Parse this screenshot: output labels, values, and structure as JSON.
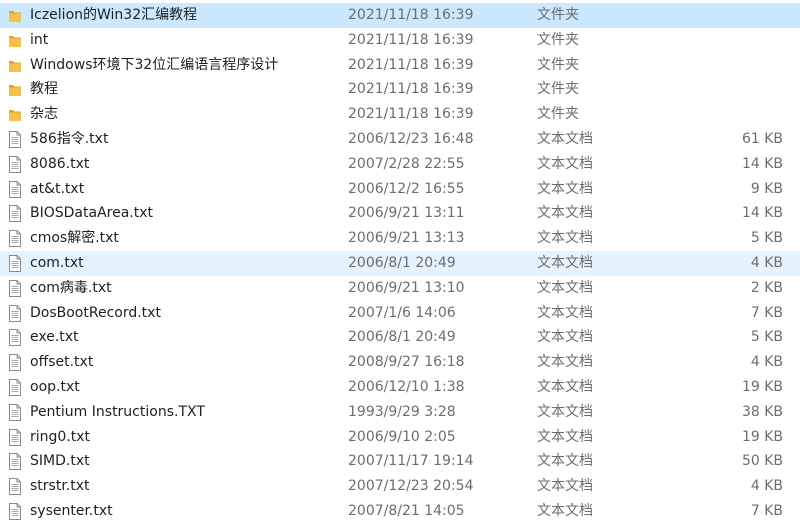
{
  "rows": [
    {
      "name": "Iczelion的Win32汇编教程",
      "date": "2021/11/18 16:39",
      "type": "文件夹",
      "size": "",
      "icon": "folder-icon",
      "state": "selected"
    },
    {
      "name": "int",
      "date": "2021/11/18 16:39",
      "type": "文件夹",
      "size": "",
      "icon": "folder-icon",
      "state": ""
    },
    {
      "name": "Windows环境下32位汇编语言程序设计",
      "date": "2021/11/18 16:39",
      "type": "文件夹",
      "size": "",
      "icon": "folder-icon",
      "state": ""
    },
    {
      "name": "教程",
      "date": "2021/11/18 16:39",
      "type": "文件夹",
      "size": "",
      "icon": "folder-icon",
      "state": ""
    },
    {
      "name": "杂志",
      "date": "2021/11/18 16:39",
      "type": "文件夹",
      "size": "",
      "icon": "folder-icon",
      "state": ""
    },
    {
      "name": "586指令.txt",
      "date": "2006/12/23 16:48",
      "type": "文本文档",
      "size": "61 KB",
      "icon": "text-file-icon",
      "state": ""
    },
    {
      "name": "8086.txt",
      "date": "2007/2/28 22:55",
      "type": "文本文档",
      "size": "14 KB",
      "icon": "text-file-icon",
      "state": ""
    },
    {
      "name": "at&t.txt",
      "date": "2006/12/2 16:55",
      "type": "文本文档",
      "size": "9 KB",
      "icon": "text-file-icon",
      "state": ""
    },
    {
      "name": "BIOSDataArea.txt",
      "date": "2006/9/21 13:11",
      "type": "文本文档",
      "size": "14 KB",
      "icon": "text-file-icon",
      "state": ""
    },
    {
      "name": "cmos解密.txt",
      "date": "2006/9/21 13:13",
      "type": "文本文档",
      "size": "5 KB",
      "icon": "text-file-icon",
      "state": ""
    },
    {
      "name": "com.txt",
      "date": "2006/8/1 20:49",
      "type": "文本文档",
      "size": "4 KB",
      "icon": "text-file-icon",
      "state": "hovered"
    },
    {
      "name": "com病毒.txt",
      "date": "2006/9/21 13:10",
      "type": "文本文档",
      "size": "2 KB",
      "icon": "text-file-icon",
      "state": ""
    },
    {
      "name": "DosBootRecord.txt",
      "date": "2007/1/6 14:06",
      "type": "文本文档",
      "size": "7 KB",
      "icon": "text-file-icon",
      "state": ""
    },
    {
      "name": "exe.txt",
      "date": "2006/8/1 20:49",
      "type": "文本文档",
      "size": "5 KB",
      "icon": "text-file-icon",
      "state": ""
    },
    {
      "name": "offset.txt",
      "date": "2008/9/27 16:18",
      "type": "文本文档",
      "size": "4 KB",
      "icon": "text-file-icon",
      "state": ""
    },
    {
      "name": "oop.txt",
      "date": "2006/12/10 1:38",
      "type": "文本文档",
      "size": "19 KB",
      "icon": "text-file-icon",
      "state": ""
    },
    {
      "name": "Pentium Instructions.TXT",
      "date": "1993/9/29 3:28",
      "type": "文本文档",
      "size": "38 KB",
      "icon": "text-file-icon",
      "state": ""
    },
    {
      "name": "ring0.txt",
      "date": "2006/9/10 2:05",
      "type": "文本文档",
      "size": "19 KB",
      "icon": "text-file-icon",
      "state": ""
    },
    {
      "name": "SIMD.txt",
      "date": "2007/11/17 19:14",
      "type": "文本文档",
      "size": "50 KB",
      "icon": "text-file-icon",
      "state": ""
    },
    {
      "name": "strstr.txt",
      "date": "2007/12/23 20:54",
      "type": "文本文档",
      "size": "4 KB",
      "icon": "text-file-icon",
      "state": ""
    },
    {
      "name": "sysenter.txt",
      "date": "2007/8/21 14:05",
      "type": "文本文档",
      "size": "7 KB",
      "icon": "text-file-icon",
      "state": ""
    }
  ],
  "colors": {
    "selected_bg": "#cce8ff",
    "hover_bg": "#e5f3ff",
    "folder_yellow": "#f2c14e",
    "folder_dark": "#dca332",
    "secondary_text": "#6d6d6d"
  }
}
